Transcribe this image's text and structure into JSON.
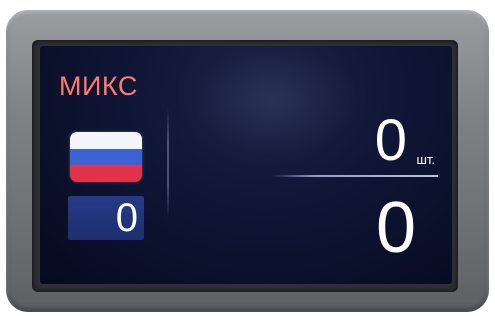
{
  "display": {
    "mode_label": "МИКС",
    "currency": {
      "flag_icon": "russia-flag-icon",
      "flag_colors": [
        "#f4f5f8",
        "#3a63d6",
        "#e2334a"
      ],
      "count": "0"
    },
    "pieces": {
      "count": "0",
      "unit": "шт."
    },
    "sum": "0"
  }
}
